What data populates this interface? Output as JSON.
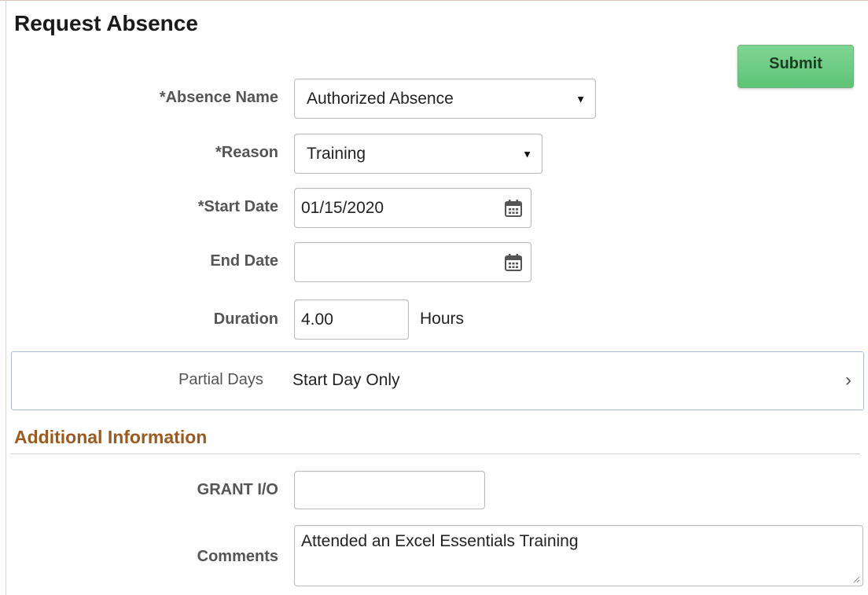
{
  "page": {
    "title": "Request Absence"
  },
  "toolbar": {
    "submit_label": "Submit"
  },
  "form": {
    "absence_name": {
      "label": "*Absence Name",
      "value": "Authorized Absence"
    },
    "reason": {
      "label": "*Reason",
      "value": "Training"
    },
    "start_date": {
      "label": "*Start Date",
      "value": "01/15/2020"
    },
    "end_date": {
      "label": "End Date",
      "value": ""
    },
    "duration": {
      "label": "Duration",
      "value": "4.00",
      "unit": "Hours"
    },
    "partial_days": {
      "label": "Partial Days",
      "value": "Start Day Only"
    }
  },
  "additional": {
    "title": "Additional Information",
    "grant_io": {
      "label": "GRANT I/O",
      "value": ""
    },
    "comments": {
      "label": "Comments",
      "value": "Attended an Excel Essentials Training"
    }
  },
  "colors": {
    "submit_green": "#6acb81",
    "section_title": "#9c5a1e",
    "partial_border": "#a9bcd8"
  },
  "icons": {
    "dropdown": "caret-down-icon",
    "calendar": "calendar-icon",
    "chevron": "chevron-right-icon",
    "resize": "resize-grip-icon"
  }
}
